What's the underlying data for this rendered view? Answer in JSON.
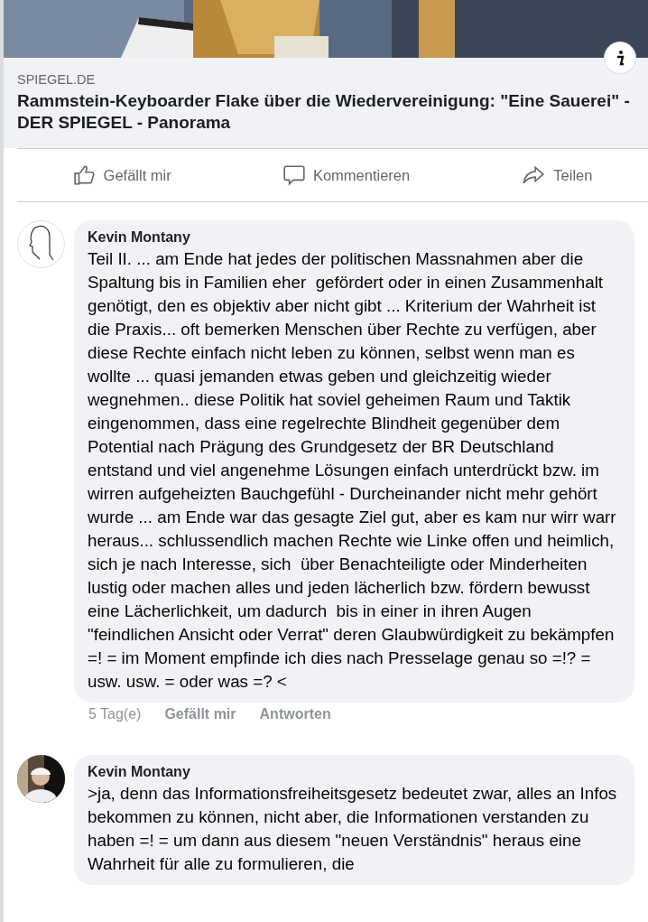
{
  "link_preview": {
    "source": "SPIEGEL.DE",
    "title": "Rammstein-Keyboarder Flake über die Wiedervereinigung: \"Eine Sauerei\" - DER SPIEGEL - Panorama"
  },
  "actions": [
    {
      "kind": "like",
      "label": "Gefällt mir"
    },
    {
      "kind": "comment",
      "label": "Kommentieren"
    },
    {
      "kind": "share",
      "label": "Teilen"
    }
  ],
  "comments": [
    {
      "kind": "sketch",
      "author": "Kevin Montany",
      "text": "Teil II. ... am Ende hat jedes der politischen Massnahmen aber die Spaltung bis in Familien eher  gefördert oder in einen Zusammenhalt genötigt, den es objektiv aber nicht gibt ... Kriterium der Wahrheit ist die Praxis... oft bemerken Menschen über Rechte zu verfügen, aber diese Rechte einfach nicht leben zu können, selbst wenn man es wollte ... quasi jemanden etwas geben und gleichzeitig wieder wegnehmen.. diese Politik hat soviel geheimen Raum und Taktik eingenommen, dass eine regelrechte Blindheit gegenüber dem Potential nach Prägung des Grundgesetz der BR Deutschland entstand und viel angenehme Lösungen einfach unterdrückt bzw. im wirren aufgeheizten Bauchgefühl - Durcheinander nicht mehr gehört wurde ... am Ende war das gesagte Ziel gut, aber es kam nur wirr warr heraus... schlussendlich machen Rechte wie Linke offen und heimlich, sich je nach Interesse, sich  über Benachteiligte oder Minderheiten lustig oder machen alles und jeden lächerlich bzw. fördern bewusst eine Lächerlichkeit, um dadurch  bis in einer in ihren Augen \"feindlichen Ansicht oder Verrat\" deren Glaubwürdigkeit zu bekämpfen =! = im Moment empfinde ich dies nach Presselage genau so =!? = usw. usw. = oder was =? <",
      "time": "5 Tag(e)",
      "like": "Gefällt mir",
      "reply": "Antworten"
    },
    {
      "author": "Kevin Montany",
      "text": ">ja, denn das Informationsfreiheitsgesetz bedeutet zwar, alles an Infos bekommen zu können, nicht aber, die Informationen verstanden zu haben =! = um dann aus diesem \"neuen Verständnis\" heraus eine Wahrheit für alle zu formulieren, die"
    }
  ]
}
